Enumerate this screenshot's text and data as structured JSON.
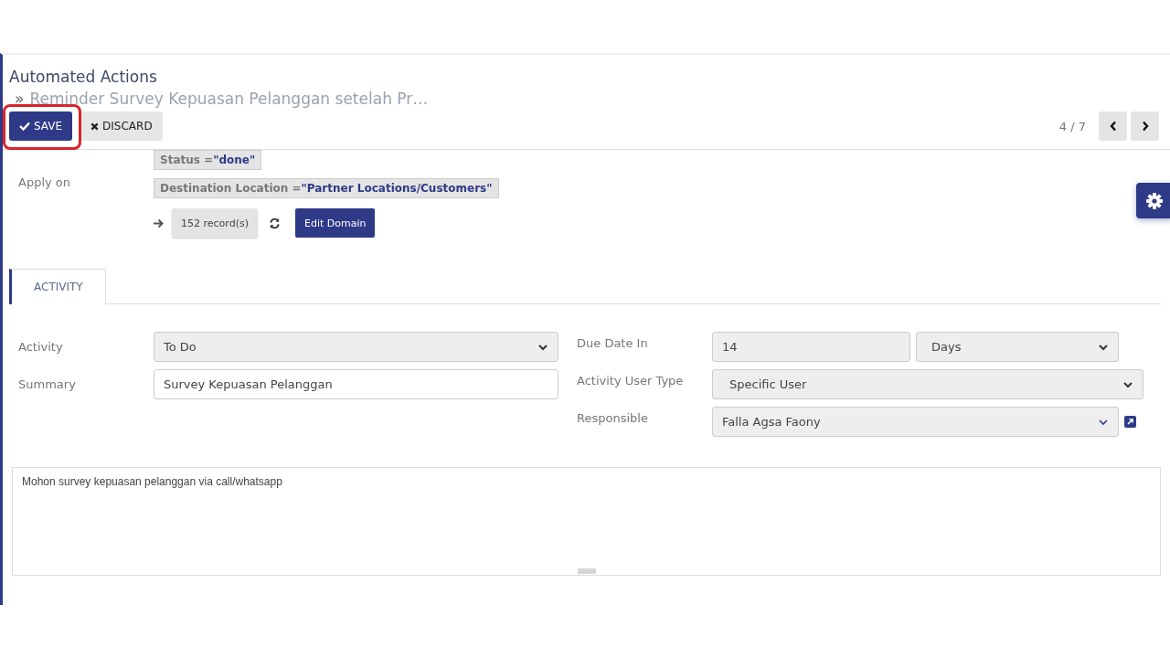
{
  "breadcrumb": {
    "parent": "Automated Actions",
    "separator": "»",
    "current": "Reminder Survey Kepuasan Pelanggan setelah Pr…"
  },
  "buttons": [
    {
      "kind": "save",
      "label": "SAVE",
      "highlighted": true
    },
    {
      "kind": "discard",
      "label": "DISCARD",
      "highlighted": false
    }
  ],
  "pager": {
    "text": "4 / 7"
  },
  "apply_on": {
    "label": "Apply on",
    "conditions": [
      {
        "field": "Status",
        "operator": "=",
        "value": "\"done\""
      },
      {
        "field": "Destination Location",
        "operator": "=",
        "value": "\"Partner Locations/Customers\""
      }
    ],
    "records": "152 record(s)",
    "edit_button": "Edit Domain"
  },
  "tabs": [
    {
      "label": "ACTIVITY",
      "selected": true
    }
  ],
  "left_fields": [
    {
      "label": "Activity",
      "kind": "select",
      "value": "To Do"
    },
    {
      "label": "Summary",
      "kind": "input",
      "value": "Survey Kepuasan Pelanggan"
    }
  ],
  "right_fields": [
    {
      "label": "Due Date In",
      "kind": "pair",
      "value": "14",
      "unit": "Days"
    },
    {
      "label": "Activity User Type",
      "kind": "select",
      "value": "Specific User"
    },
    {
      "label": "Responsible",
      "kind": "many2one",
      "value": "Falla Agsa Faony"
    }
  ],
  "note": "Mohon survey kepuasan pelanggan via call/whatsapp"
}
